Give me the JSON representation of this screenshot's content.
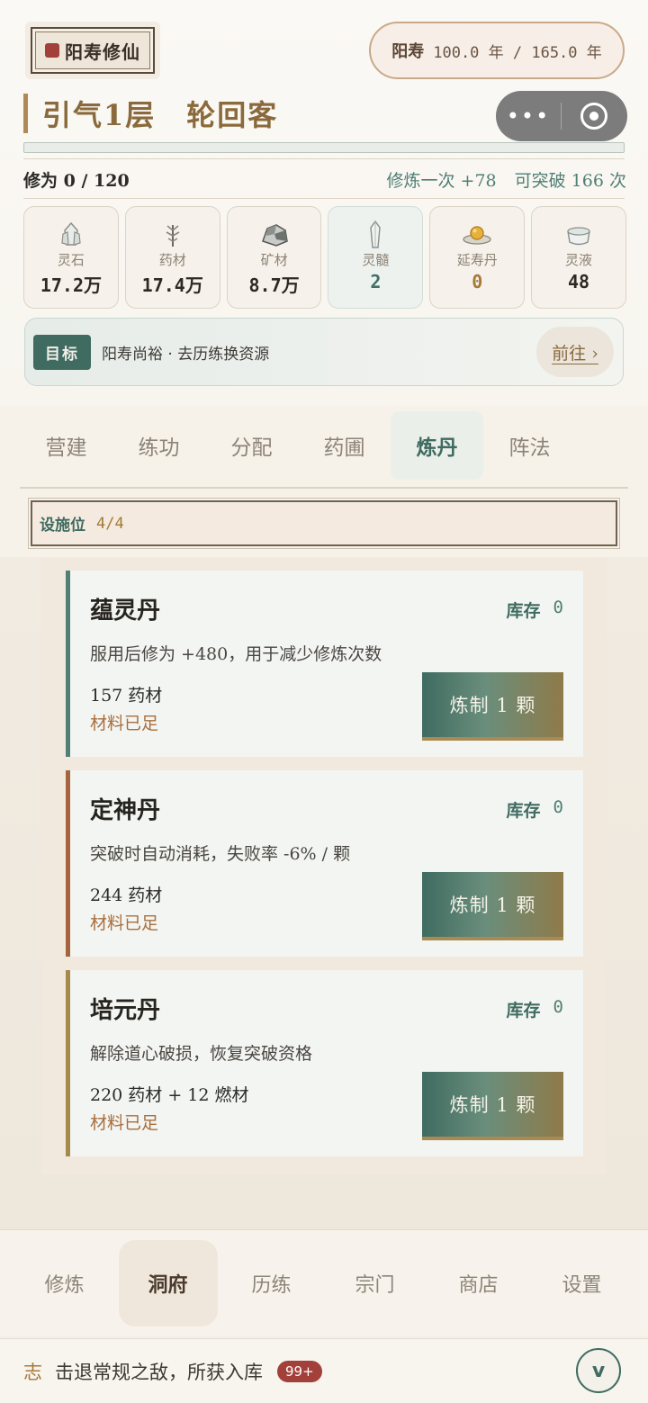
{
  "header": {
    "logo_text": "阳寿修仙",
    "lifespan_label": "阳寿",
    "lifespan_value": "100.0 年 / 165.0 年"
  },
  "realm": {
    "level": "引气1层",
    "title": "轮回客"
  },
  "capsule": {
    "more_icon": "more-dots-icon",
    "close_icon": "close-circle-icon"
  },
  "cultivation": {
    "label": "修为",
    "value": "0 / 120",
    "progress_fraction": 0,
    "per_practice": "修炼一次 +78",
    "breakthrough": "可突破 166 次"
  },
  "resources": [
    {
      "name": "灵石",
      "value": "17.2万",
      "icon": "spirit-stone-icon"
    },
    {
      "name": "药材",
      "value": "17.4万",
      "icon": "herb-icon"
    },
    {
      "name": "矿材",
      "value": "8.7万",
      "icon": "ore-icon"
    },
    {
      "name": "灵髓",
      "value": "2",
      "icon": "crystal-icon"
    },
    {
      "name": "延寿丹",
      "value": "0",
      "icon": "longevity-pill-icon"
    },
    {
      "name": "灵液",
      "value": "48",
      "icon": "spirit-liquid-icon"
    }
  ],
  "goal": {
    "tag": "目标",
    "text": "阳寿尚裕 · 去历练换资源",
    "go_label": "前往 ›"
  },
  "tabs": [
    {
      "label": "营建"
    },
    {
      "label": "练功"
    },
    {
      "label": "分配"
    },
    {
      "label": "药圃"
    },
    {
      "label": "炼丹"
    },
    {
      "label": "阵法"
    }
  ],
  "facility": {
    "label": "设施位",
    "value": "4/4"
  },
  "recipes": [
    {
      "name": "蕴灵丹",
      "stock_label": "库存",
      "stock": "0",
      "desc": "服用后修为 +480，用于减少修炼次数",
      "cost": "157 药材",
      "status": "材料已足",
      "button": "炼制 1 颗",
      "accent": "#4f7f76"
    },
    {
      "name": "定神丹",
      "stock_label": "库存",
      "stock": "0",
      "desc": "突破时自动消耗，失败率 -6% / 颗",
      "cost": "244 药材",
      "status": "材料已足",
      "button": "炼制 1 颗",
      "accent": "#a5633e"
    },
    {
      "name": "培元丹",
      "stock_label": "库存",
      "stock": "0",
      "desc": "解除道心破损，恢复突破资格",
      "cost": "220 药材 + 12 燃材",
      "status": "材料已足",
      "button": "炼制 1 颗",
      "accent": "#a58a4e"
    }
  ],
  "bottom_nav": [
    {
      "label": "修炼"
    },
    {
      "label": "洞府"
    },
    {
      "label": "历练"
    },
    {
      "label": "宗门"
    },
    {
      "label": "商店"
    },
    {
      "label": "设置"
    }
  ],
  "log": {
    "icon_char": "志",
    "text": "击退常规之敌，所获入库",
    "badge": "99+",
    "toggle": "v"
  }
}
